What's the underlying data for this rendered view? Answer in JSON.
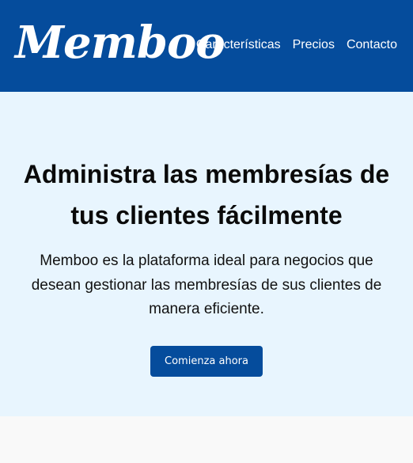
{
  "header": {
    "logo_text": "Memboo",
    "nav": [
      "Características",
      "Precios",
      "Contacto"
    ]
  },
  "hero": {
    "title": "Administra las membresías de tus clientes fácilmente",
    "description": "Memboo es la plataforma ideal para negocios que desean gestionar las membresías de sus clientes de manera eficiente.",
    "cta_label": "Comienza ahora"
  },
  "colors": {
    "brand": "#054c9c",
    "hero_background": "#e8f5fe",
    "page_background": "#f9f9f9"
  }
}
